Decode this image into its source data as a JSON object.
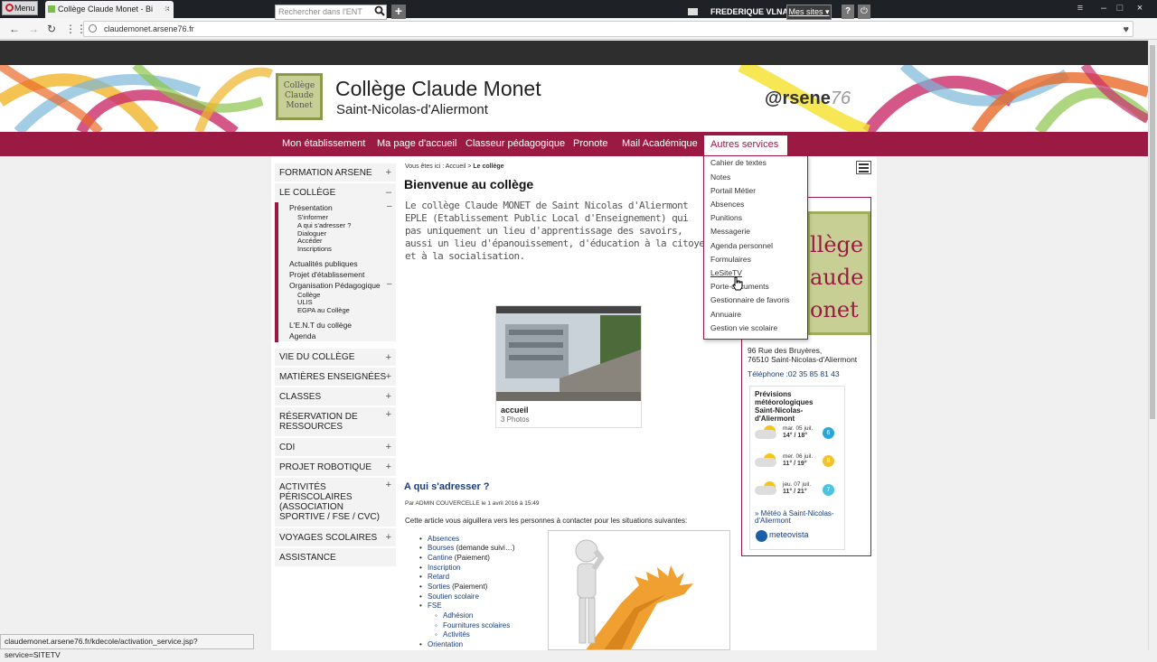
{
  "browser": {
    "menu_label": "Menu",
    "tab_title": "Collège Claude Monet - Bi",
    "url": "claudemonet.arsene76.fr",
    "status_url": "claudemonet.arsene76.fr/kdecole/activation_service.jsp?service=SITETV"
  },
  "ent": {
    "search_placeholder": "Rechercher dans l'ENT",
    "user_name": "FREDERIQUE VLNA",
    "my_sites": "Mes sites",
    "help": "?"
  },
  "header": {
    "logo_lines": [
      "Collège",
      "Claude",
      "Monet"
    ],
    "title": "Collège Claude Monet",
    "subtitle": "Saint-Nicolas-d'Aliermont",
    "brand_main": "@rsene",
    "brand_num": "76"
  },
  "nav": {
    "items": [
      "Mon établissement",
      "Ma page d'accueil",
      "Classeur pédagogique",
      "Pronote",
      "Mail Académique"
    ],
    "autres": "Autres services"
  },
  "dropdown": [
    "Cahier de textes",
    "Notes",
    "Portail Métier",
    "Absences",
    "Punitions",
    "Messagerie",
    "Agenda personnel",
    "Formulaires",
    "LeSiteTV",
    "Porte-documents",
    "Gestionnaire de favoris",
    "Annuaire",
    "Gestion vie scolaire"
  ],
  "sidebar": {
    "formation": "FORMATION ARSENE",
    "college": "LE COLLÈGE",
    "presentation": "Présentation",
    "pres_items": [
      "S'informer",
      "A qui s'adresser ?",
      "Dialoguer",
      "Accéder",
      "Inscriptions"
    ],
    "actualites": "Actualités publiques",
    "projet": "Projet d'établissement",
    "orga": "Organisation Pédagogique",
    "orga_items": [
      "Collège",
      "ULIS",
      "EGPA au Collège"
    ],
    "ent_college": "L'E.N.T du collège",
    "agenda": "Agenda",
    "vie": "VIE DU COLLÈGE",
    "matieres": "MATIÈRES ENSEIGNÉES",
    "classes": "CLASSES",
    "reservation": [
      "RÉSERVATION DE",
      "RESSOURCES"
    ],
    "cdi": "CDI",
    "robotique": "PROJET ROBOTIQUE",
    "activites": [
      "ACTIVITÉS",
      "PÉRISCOLAIRES",
      "(ASSOCIATION",
      "SPORTIVE / FSE / CVC)"
    ],
    "voyages": "VOYAGES SCOLAIRES",
    "assistance": "ASSISTANCE"
  },
  "main": {
    "crumb_prefix": "Vous êtes ici :",
    "crumb_home": "Accueil",
    "crumb_sep": ">",
    "crumb_current": "Le collège",
    "heading": "Bienvenue au collège",
    "intro": [
      "Le collège Claude MONET de Saint Nicolas d'Aliermont",
      "EPLE (Etablissement Public Local d'Enseignement) qui",
      "pas uniquement un lieu d'apprentissage des savoirs,",
      "aussi un lieu d'épanouissement, d'éducation à la citoye",
      "et à la socialisation."
    ],
    "album_title": "accueil",
    "album_count": "3 Photos",
    "aqui_heading": "A qui s'adresser ?",
    "byline": "Par ADMIN COUVERCELLE le 1 avril 2016 à 15:49",
    "article_text": "Cette article vous aiguillera vers les personnes à contacter pour les situations suivantes:",
    "list": [
      {
        "text": "Absences",
        "link": true
      },
      {
        "text": "Bourses",
        "link": true,
        "extra": " (demande suivi…)"
      },
      {
        "text": "Cantine",
        "link": true,
        "extra": " (Paiement)"
      },
      {
        "text": "Inscription",
        "link": true
      },
      {
        "text": "Retard",
        "link": true
      },
      {
        "text": "Sorties",
        "link": true,
        "extra": " (Paiement)"
      },
      {
        "text": "Soutien scolaire",
        "link": true
      },
      {
        "text": "FSE",
        "link": true
      }
    ],
    "fse_sub": [
      "Adhésion",
      "Fournitures scolaires",
      "Activités"
    ],
    "orientation": "Orientation"
  },
  "right": {
    "logo_text": [
      "llège",
      "aude",
      "onet"
    ],
    "addr1": "96 Rue des Bruyères,",
    "addr2": "76510 Saint-Nicolas-d'Aliermont",
    "tel": "Téléphone :02 35 85 81 43",
    "meteo_title": [
      "Prévisions",
      "météorologiques",
      "Saint-Nicolas-d'Aliermont"
    ],
    "forecast": [
      {
        "day": "mar. 05 juil.",
        "temp": "14° / 18°",
        "wind": "6",
        "wind_color": "#29a6d9"
      },
      {
        "day": "mer. 06 juil.",
        "temp": "11° / 19°",
        "wind": "8",
        "wind_color": "#f2c12e"
      },
      {
        "day": "jeu. 07 juil.",
        "temp": "11° / 21°",
        "wind": "7",
        "wind_color": "#4dc3e0"
      }
    ],
    "meteo_link": [
      "» Météo à Saint-Nicolas-",
      "d'Aliermont"
    ],
    "meteovista": "meteovista"
  },
  "colors": {
    "accent": "#9b1a44",
    "link": "#1a3d7a"
  }
}
